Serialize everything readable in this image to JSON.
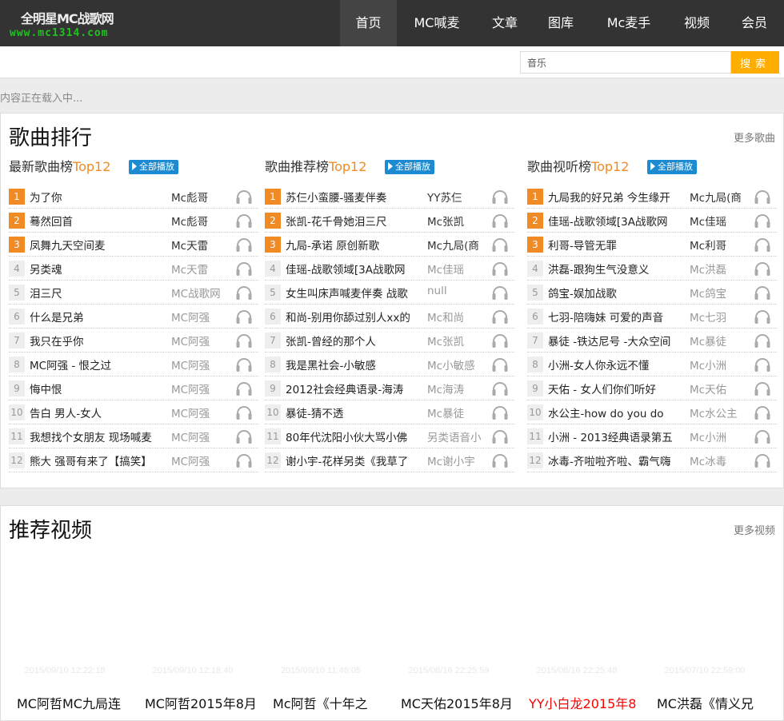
{
  "logo": {
    "title": "全明星MC战歌网",
    "url": "www.mc1314.com"
  },
  "nav": [
    {
      "label": "首页"
    },
    {
      "label": "MC喊麦"
    },
    {
      "label": "文章"
    },
    {
      "label": "图库"
    },
    {
      "label": "Mc麦手"
    },
    {
      "label": "视频"
    },
    {
      "label": "会员"
    }
  ],
  "search": {
    "value": "音乐",
    "button": "搜索"
  },
  "loading": "内容正在载入中...",
  "songs": {
    "title": "歌曲排行",
    "more": "更多歌曲",
    "play_all": "全部播放",
    "lists": [
      {
        "name": "最新歌曲榜",
        "suffix": "Top12",
        "items": [
          {
            "n": "1",
            "title": "为了你",
            "artist": "Mc彪哥"
          },
          {
            "n": "2",
            "title": "蓦然回首",
            "artist": "Mc彪哥"
          },
          {
            "n": "3",
            "title": "凤舞九天空间麦",
            "artist": "Mc天雷"
          },
          {
            "n": "4",
            "title": "另类魂",
            "artist": "Mc天雷"
          },
          {
            "n": "5",
            "title": "泪三尺",
            "artist": "MC战歌网"
          },
          {
            "n": "6",
            "title": "什么是兄弟",
            "artist": "MC阿强"
          },
          {
            "n": "7",
            "title": "我只在乎你",
            "artist": "MC阿强"
          },
          {
            "n": "8",
            "title": "MC阿强 - 恨之过",
            "artist": "MC阿强"
          },
          {
            "n": "9",
            "title": "悔中恨",
            "artist": "MC阿强"
          },
          {
            "n": "10",
            "title": "告白 男人-女人",
            "artist": "MC阿强"
          },
          {
            "n": "11",
            "title": "我想找个女朋友 现场喊麦",
            "artist": "MC阿强"
          },
          {
            "n": "12",
            "title": "熊大 强哥有来了【搞笑】",
            "artist": "MC阿强"
          }
        ]
      },
      {
        "name": "歌曲推荐榜",
        "suffix": "Top12",
        "items": [
          {
            "n": "1",
            "title": "苏仨小蛮腰-骚麦伴奏",
            "artist": "YY苏仨"
          },
          {
            "n": "2",
            "title": "张凯-花千骨她泪三尺",
            "artist": "Mc张凯"
          },
          {
            "n": "3",
            "title": "九局-承诺 原创新歌",
            "artist": "Mc九局(商"
          },
          {
            "n": "4",
            "title": "佳瑶-战歌领域[3A战歌网",
            "artist": "Mc佳瑶"
          },
          {
            "n": "5",
            "title": "女生叫床声喊麦伴奏 战歌",
            "artist": "null"
          },
          {
            "n": "6",
            "title": "和尚-别用你舔过别人xx的",
            "artist": "Mc和尚"
          },
          {
            "n": "7",
            "title": "张凯-曾经的那个人",
            "artist": "Mc张凯"
          },
          {
            "n": "8",
            "title": "我是黑社会-小敏感",
            "artist": "Mc小敏感"
          },
          {
            "n": "9",
            "title": "2012社会经典语录-海涛",
            "artist": "Mc海涛"
          },
          {
            "n": "10",
            "title": "暴徒-猜不透",
            "artist": "Mc暴徒"
          },
          {
            "n": "11",
            "title": "80年代沈阳小伙大骂小佛",
            "artist": "另类语音小"
          },
          {
            "n": "12",
            "title": "谢小宇-花样另类《我草了",
            "artist": "Mc谢小宇"
          }
        ]
      },
      {
        "name": "歌曲视听榜",
        "suffix": "Top12",
        "items": [
          {
            "n": "1",
            "title": "九局我的好兄弟 今生缘开",
            "artist": "Mc九局(商"
          },
          {
            "n": "2",
            "title": "佳瑶-战歌领域[3A战歌网",
            "artist": "Mc佳瑶"
          },
          {
            "n": "3",
            "title": "利哥-导管无罪",
            "artist": "Mc利哥"
          },
          {
            "n": "4",
            "title": "洪磊-跟狗生气没意义",
            "artist": "Mc洪磊"
          },
          {
            "n": "5",
            "title": "鸽宝-娱加战歌",
            "artist": "Mc鸽宝"
          },
          {
            "n": "6",
            "title": "七羽-陪嗨妹 可爱的声音",
            "artist": "Mc七羽"
          },
          {
            "n": "7",
            "title": "暴徒 -铁达尼号 -大众空间",
            "artist": "Mc暴徒"
          },
          {
            "n": "8",
            "title": "小洲-女人你永远不懂",
            "artist": "Mc小洲"
          },
          {
            "n": "9",
            "title": "天佑 - 女人们你们听好",
            "artist": "Mc天佑"
          },
          {
            "n": "10",
            "title": "水公主-how do you do",
            "artist": "Mc水公主"
          },
          {
            "n": "11",
            "title": "小洲 - 2013经典语录第五",
            "artist": "Mc小洲"
          },
          {
            "n": "12",
            "title": "冰毒-齐啦啦齐啦、霸气嗨",
            "artist": "Mc冰毒"
          }
        ]
      }
    ]
  },
  "videos": {
    "title": "推荐视频",
    "more": "更多视频",
    "items": [
      {
        "date": "2015/09/10 12:22:18",
        "title": "MC阿哲MC九局连"
      },
      {
        "date": "2015/09/10 12:18:40",
        "title": "MC阿哲2015年8月"
      },
      {
        "date": "2015/09/10 11:46:05",
        "title": "Mc阿哲《十年之"
      },
      {
        "date": "2015/08/16 22:25:59",
        "title": "MC天佑2015年8月"
      },
      {
        "date": "2015/08/16 22:25:48",
        "title": "YY小白龙2015年8",
        "highlight": true
      },
      {
        "date": "2015/07/10 22:59:00",
        "title": "MC洪磊《情义兄"
      }
    ]
  },
  "colors": {
    "header": "#333333",
    "accent": "#f08a24",
    "search_button": "#ffae00",
    "play_all": "#1d8bd1",
    "highlight": "#ff0000"
  }
}
